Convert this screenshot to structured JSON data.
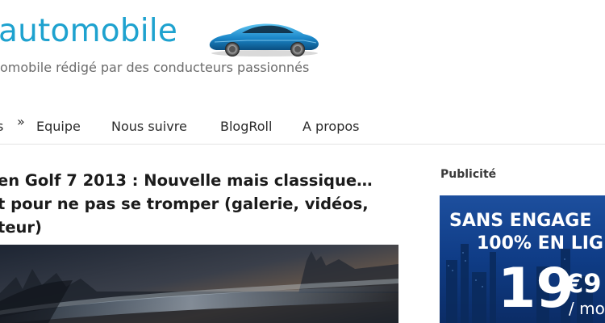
{
  "header": {
    "site_title": "automobile",
    "tagline": "omobile rédigé par des conducteurs passionnés",
    "logo_icon": "sports-car-icon",
    "accent_color": "#1ea2cf"
  },
  "nav": {
    "cut_item": "s",
    "chevron": "»",
    "items": [
      {
        "label": "Equipe"
      },
      {
        "label": "Nous suivre"
      },
      {
        "label": "BlogRoll"
      },
      {
        "label": "A propos"
      }
    ]
  },
  "article": {
    "title_lines": [
      "en Golf 7 2013 : Nouvelle mais classique…",
      "t pour ne pas se tromper (galerie, vidéos,",
      "teur)"
    ]
  },
  "sidebar": {
    "heading": "Publicité",
    "ad": {
      "line1": "SANS ENGAGE",
      "line2": "100% EN LIG",
      "price_main": "19",
      "price_cents": "€9",
      "price_unit": "/ mo"
    }
  }
}
